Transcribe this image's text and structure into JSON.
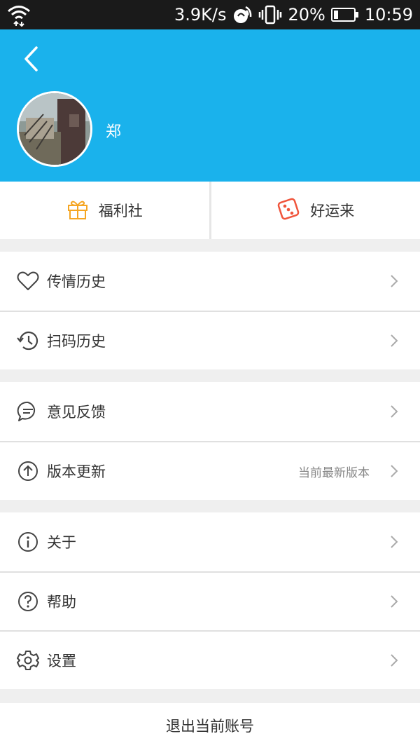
{
  "status": {
    "speed": "3.9K/s",
    "battery": "20%",
    "time": "10:59",
    "icons": [
      "wifi-icon",
      "nfc-icon",
      "vibrate-icon",
      "battery-icon"
    ]
  },
  "header": {
    "username": "郑",
    "accent_color": "#1ab2ec"
  },
  "quick": {
    "welfare": "福利社",
    "luck": "好运来"
  },
  "menu": {
    "love_history": "传情历史",
    "scan_history": "扫码历史",
    "feedback": "意见反馈",
    "version_update": "版本更新",
    "version_status": "当前最新版本",
    "about": "关于",
    "help": "帮助",
    "settings": "设置"
  },
  "logout": "退出当前账号"
}
